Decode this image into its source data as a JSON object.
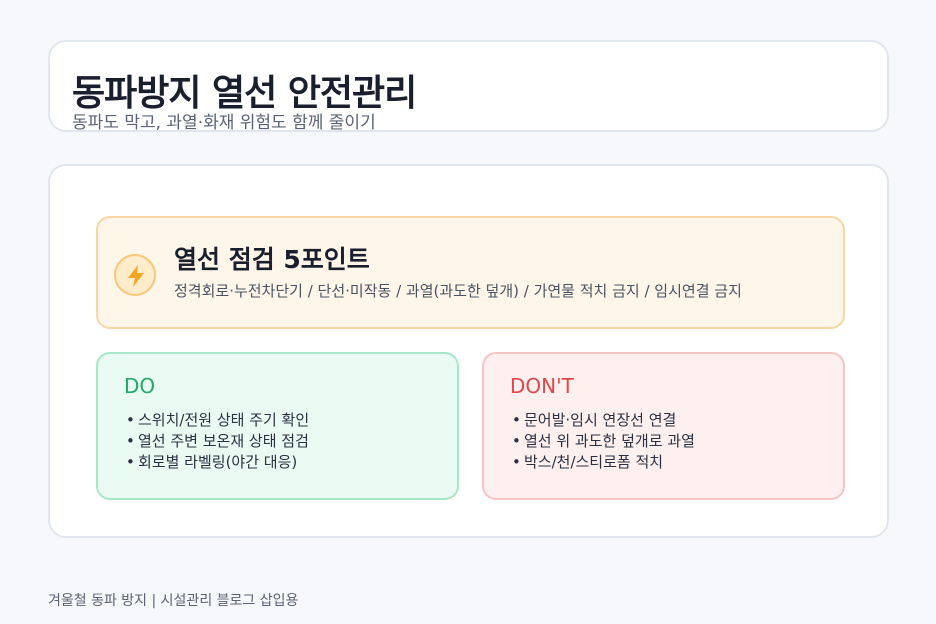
{
  "header": {
    "title": "동파방지 열선 안전관리",
    "subtitle": "동파도 막고, 과열·화재 위험도 함께 줄이기"
  },
  "inspection": {
    "icon": "lightning-bolt-icon",
    "title": "열선 점검 5포인트",
    "text": "정격회로·누전차단기 / 단선·미작동 / 과열(과도한 덮개) / 가연물 적치 금지 / 임시연결 금지"
  },
  "do": {
    "heading": "DO",
    "items": [
      "스위치/전원 상태 주기 확인",
      "열선 주변 보온재 상태 점검",
      "회로별 라벨링(야간 대응)"
    ]
  },
  "dont": {
    "heading": "DON'T",
    "items": [
      "문어발·임시 연장선 연결",
      "열선 위 과도한 덮개로 과열",
      "박스/천/스티로폼 적치"
    ]
  },
  "footer": {
    "text": "겨울철 동파 방지 | 시설관리 블로그 삽입용"
  },
  "colors": {
    "accent_orange": "#f5a623",
    "do_green": "#1eaa6a",
    "dont_red": "#e4474a"
  }
}
